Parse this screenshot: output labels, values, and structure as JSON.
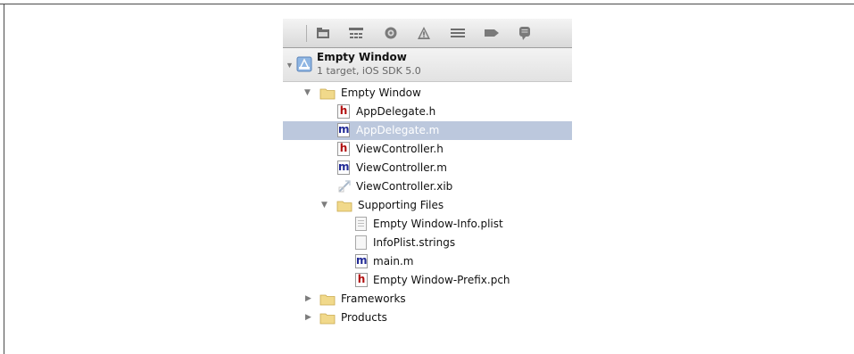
{
  "toolbar": {
    "icons": [
      "project-navigator-icon",
      "symbol-navigator-icon",
      "search-navigator-icon",
      "issue-navigator-icon",
      "debug-navigator-icon",
      "breakpoint-navigator-icon",
      "log-navigator-icon"
    ]
  },
  "project": {
    "title": "Empty Window",
    "subtitle": "1 target, iOS SDK 5.0"
  },
  "tree": {
    "group_empty_window": "Empty Window",
    "appdelegate_h": "AppDelegate.h",
    "appdelegate_m": "AppDelegate.m",
    "viewcontroller_h": "ViewController.h",
    "viewcontroller_m": "ViewController.m",
    "viewcontroller_xib": "ViewController.xib",
    "group_supporting_files": "Supporting Files",
    "info_plist": "Empty Window-Info.plist",
    "infoplist_strings": "InfoPlist.strings",
    "main_m": "main.m",
    "prefix_pch": "Empty Window-Prefix.pch",
    "group_frameworks": "Frameworks",
    "group_products": "Products"
  },
  "file_badges": {
    "header": "h",
    "implementation": "m"
  },
  "selected_item": "AppDelegate.m",
  "colors": {
    "selection": "#bcc8dd",
    "header_badge": "#b01010",
    "impl_badge": "#222b96",
    "folder": "#f1d98b"
  }
}
